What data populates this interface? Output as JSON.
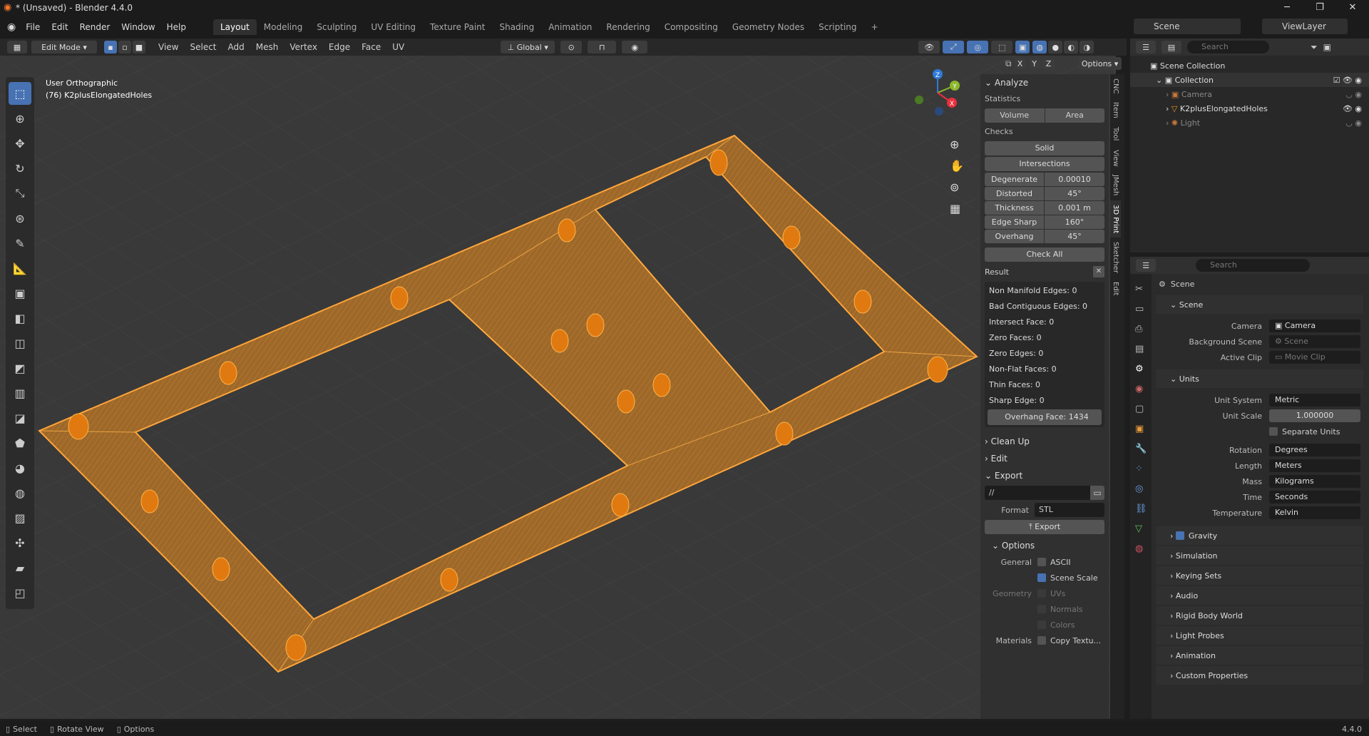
{
  "window": {
    "title": "* (Unsaved) - Blender 4.4.0",
    "min": "─",
    "max": "❐",
    "close": "✕"
  },
  "menu": [
    "File",
    "Edit",
    "Render",
    "Window",
    "Help"
  ],
  "workspaces": [
    "Layout",
    "Modeling",
    "Sculpting",
    "UV Editing",
    "Texture Paint",
    "Shading",
    "Animation",
    "Rendering",
    "Compositing",
    "Geometry Nodes",
    "Scripting",
    "+"
  ],
  "scene_field": "Scene",
  "viewlayer_field": "ViewLayer",
  "header": {
    "mode": "Edit Mode",
    "menus": [
      "View",
      "Select",
      "Add",
      "Mesh",
      "Vertex",
      "Edge",
      "Face",
      "UV"
    ],
    "orientation": "Global",
    "options": "Options",
    "xyz": [
      "X",
      "Y",
      "Z"
    ]
  },
  "viewport": {
    "view_name": "User Orthographic",
    "object_name": "(76) K2plusElongatedHoles"
  },
  "gizmo": {
    "x": "X",
    "y": "Y",
    "z": "Z"
  },
  "npanel": {
    "analyze": "Analyze",
    "statistics": "Statistics",
    "volume": "Volume",
    "area": "Area",
    "checks": "Checks",
    "solid": "Solid",
    "intersections": "Intersections",
    "rows": [
      {
        "k": "Degenerate",
        "v": "0.00010"
      },
      {
        "k": "Distorted",
        "v": "45°"
      },
      {
        "k": "Thickness",
        "v": "0.001 m"
      },
      {
        "k": "Edge Sharp",
        "v": "160°"
      },
      {
        "k": "Overhang",
        "v": "45°"
      }
    ],
    "check_all": "Check All",
    "result": "Result",
    "results": [
      "Non Manifold Edges: 0",
      "Bad Contiguous Edges: 0",
      "Intersect Face: 0",
      "Zero Faces: 0",
      "Zero Edges: 0",
      "Non-Flat Faces: 0",
      "Thin Faces: 0",
      "Sharp Edge: 0"
    ],
    "overhang_face": "Overhang Face: 1434",
    "clean_up": "Clean Up",
    "edit": "Edit",
    "export": "Export",
    "path": "//",
    "format_label": "Format",
    "format": "STL",
    "export_btn": "Export",
    "options": "Options",
    "general": "General",
    "ascii": "ASCII",
    "scene_scale": "Scene Scale",
    "geometry": "Geometry",
    "uvs": "UVs",
    "normals": "Normals",
    "colors": "Colors",
    "materials": "Materials",
    "copy_tex": "Copy Textu..."
  },
  "sidetabs": [
    "CNC",
    "Item",
    "Tool",
    "View",
    "JMesh",
    "3D Print",
    "Sketcher",
    "Edit"
  ],
  "outliner": {
    "search": "Search",
    "root": "Scene Collection",
    "collection": "Collection",
    "items": [
      "Camera",
      "K2plusElongatedHoles",
      "Light"
    ]
  },
  "props": {
    "search": "Search",
    "scene_title": "Scene",
    "scene_section": "Scene",
    "camera_label": "Camera",
    "camera": "Camera",
    "bg_label": "Background Scene",
    "bg": "Scene",
    "clip_label": "Active Clip",
    "clip": "Movie Clip",
    "units": "Units",
    "unit_rows": [
      {
        "k": "Unit System",
        "v": "Metric"
      },
      {
        "k": "Unit Scale",
        "v": "1.000000"
      }
    ],
    "separate_units": "Separate Units",
    "unit_rows2": [
      {
        "k": "Rotation",
        "v": "Degrees"
      },
      {
        "k": "Length",
        "v": "Meters"
      },
      {
        "k": "Mass",
        "v": "Kilograms"
      },
      {
        "k": "Time",
        "v": "Seconds"
      },
      {
        "k": "Temperature",
        "v": "Kelvin"
      }
    ],
    "sections": [
      "Gravity",
      "Simulation",
      "Keying Sets",
      "Audio",
      "Rigid Body World",
      "Light Probes",
      "Animation",
      "Custom Properties"
    ]
  },
  "status": {
    "select": "Select",
    "rotate": "Rotate View",
    "options": "Options",
    "version": "4.4.0"
  },
  "colors": {
    "mesh": "#f0901e",
    "accent": "#4772b3"
  }
}
